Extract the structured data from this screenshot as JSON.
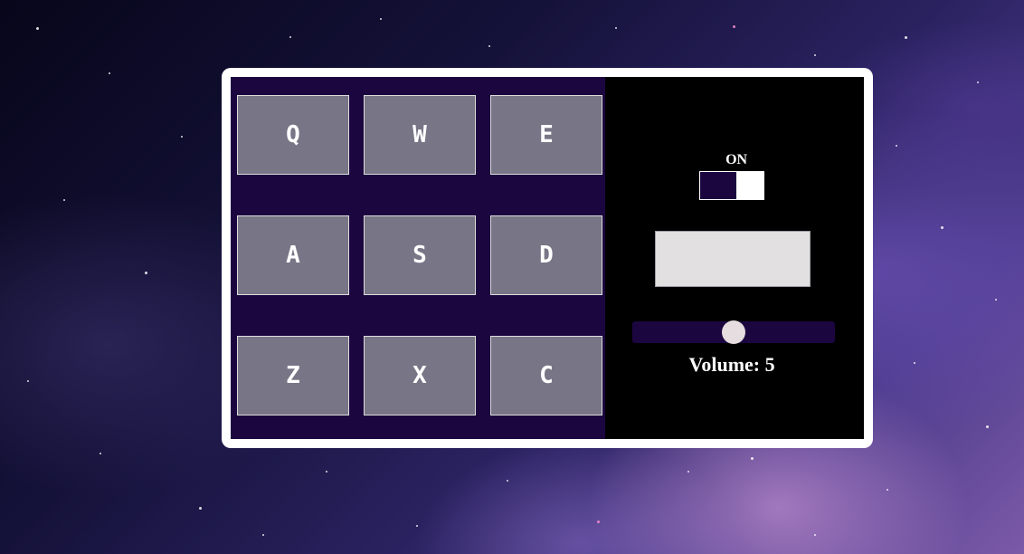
{
  "pads": [
    {
      "key": "Q"
    },
    {
      "key": "W"
    },
    {
      "key": "E"
    },
    {
      "key": "A"
    },
    {
      "key": "S"
    },
    {
      "key": "D"
    },
    {
      "key": "Z"
    },
    {
      "key": "X"
    },
    {
      "key": "C"
    }
  ],
  "power": {
    "label": "ON",
    "state": true
  },
  "display": {
    "text": ""
  },
  "volume": {
    "label": "Volume: 5",
    "value": 5,
    "max": 10
  },
  "colors": {
    "pad_bank": "#1c0640",
    "pad": "#787586",
    "controls_bg": "#000000",
    "display_bg": "#e2e0e0",
    "frame": "#ffffff"
  }
}
